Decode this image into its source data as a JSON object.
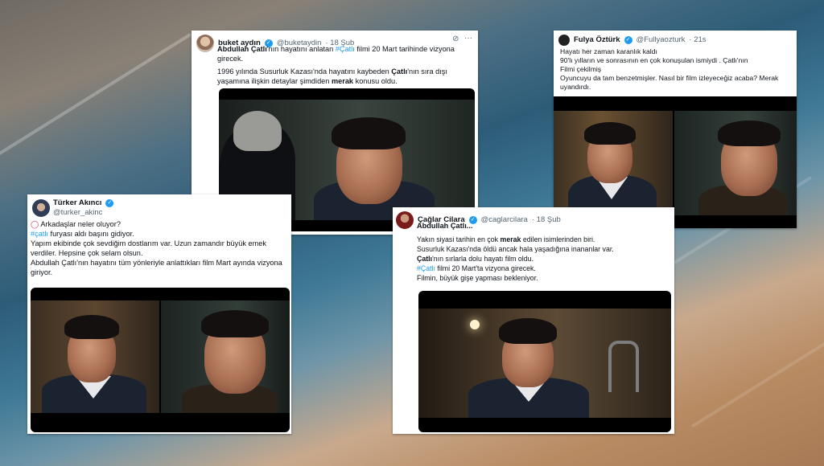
{
  "tweets": {
    "buket": {
      "name": "buket aydın",
      "handle": "@buketaydin",
      "time": "· 18 Şub",
      "line1_a": "Abdullah Çatlı",
      "line1_b": "'nın hayatını anlatan ",
      "line1_tag": "#Çatlı",
      "line1_c": " filmi 20 Mart tarihinde vizyona girecek.",
      "line2_a": "1996 yılında Susurluk Kazası'nda hayatını kaybeden ",
      "line2_b": "Çatlı",
      "line2_c": "'nın sıra dışı yaşamına ilişkin detaylar şimdiden ",
      "line2_d": "merak",
      "line2_e": " konusu oldu."
    },
    "fulya": {
      "name": "Fulya Öztürk",
      "handle": "@Fullyaozturk",
      "time": "· 21s",
      "l1": "Hayatı her zaman karanlık kaldı",
      "l2": "90'lı yılların ve sonrasının en çok konuşulan ismiydi . Çatlı'nın",
      "l3": "Filmi çekilmiş",
      "l4": "Oyuncuyu da tam benzetmişler. Nasıl bir film izleyeceğiz acaba? Merak uyandırdı."
    },
    "turker": {
      "name": "Türker Akıncı",
      "handle": "@turker_akinc",
      "l1": "Arkadaşlar neler oluyor?",
      "l2_tag": "#çatlı",
      "l2": " furyası aldı başını gidiyor.",
      "l3": "Yapım ekibinde çok sevdiğim dostlarım var. Uzun zamandır büyük emek verdiler. Hepsine çok selam olsun.",
      "l4": "Abdullah Çatlı'nın hayatını tüm yönleriyle anlattıkları film Mart ayında vizyona giriyor."
    },
    "caglar": {
      "name": "Çağlar Cilara",
      "handle": "@caglarcilara",
      "time": "· 18 Şub",
      "title": "Abdullah Çatlı...",
      "l1_a": "Yakın siyasi tarihin en çok ",
      "l1_b": "merak",
      "l1_c": " edilen isimlerinden biri.",
      "l2": "Susurluk Kazası'nda öldü ancak hala yaşadığına inananlar var.",
      "l3_a": "Çatlı",
      "l3_b": "'nın sırlarla dolu hayatı film oldu.",
      "l4_tag": "#Çatlı",
      "l4": " filmi 20 Mart'ta vizyona girecek.",
      "l5": "Filmin, büyük gişe yapması bekleniyor."
    }
  },
  "icons": {
    "verified": "✓",
    "grok": "⊘",
    "more": "···",
    "circle": "◯"
  },
  "colors": {
    "link": "#1d9bf0",
    "verified": "#1d9bf0",
    "text": "#0f1419",
    "muted": "#536471"
  }
}
